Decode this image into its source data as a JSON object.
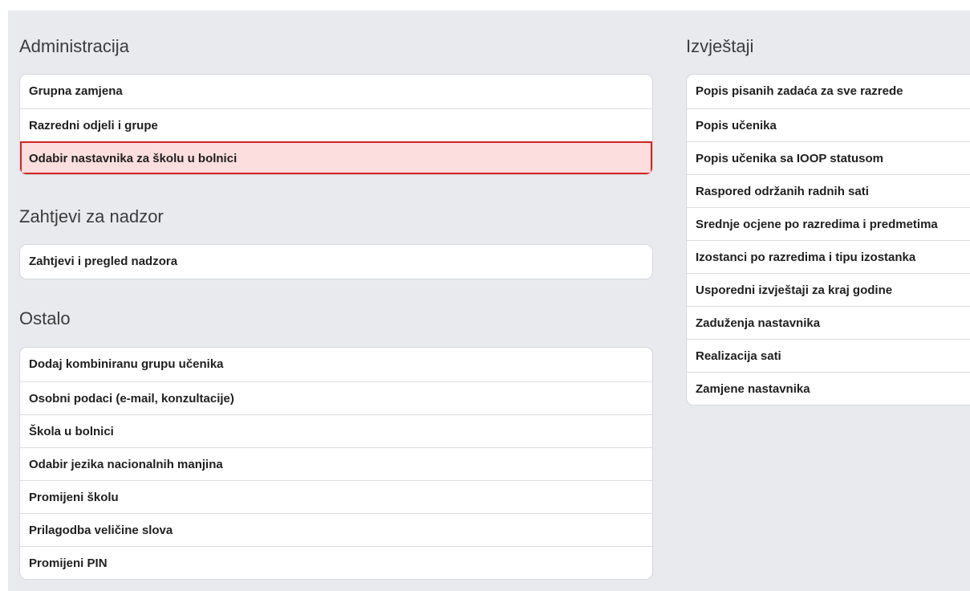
{
  "sections": {
    "administracija": {
      "title": "Administracija",
      "items": [
        {
          "label": "Grupna zamjena"
        },
        {
          "label": "Razredni odjeli i grupe"
        },
        {
          "label": "Odabir nastavnika za školu u bolnici"
        }
      ],
      "selected_index": 2
    },
    "nadzor": {
      "title": "Zahtjevi za nadzor",
      "items": [
        {
          "label": "Zahtjevi i pregled nadzora"
        }
      ]
    },
    "ostalo": {
      "title": "Ostalo",
      "items": [
        {
          "label": "Dodaj kombiniranu grupu učenika"
        },
        {
          "label": "Osobni podaci (e-mail, konzultacije)"
        },
        {
          "label": "Škola u bolnici"
        },
        {
          "label": "Odabir jezika nacionalnih manjina"
        },
        {
          "label": "Promijeni školu"
        },
        {
          "label": "Prilagodba veličine slova"
        },
        {
          "label": "Promijeni PIN"
        }
      ]
    },
    "izvjestaji": {
      "title": "Izvještaji",
      "items": [
        {
          "label": "Popis pisanih zadaća za sve razrede"
        },
        {
          "label": "Popis učenika"
        },
        {
          "label": "Popis učenika sa IOOP statusom"
        },
        {
          "label": "Raspored održanih radnih sati"
        },
        {
          "label": "Srednje ocjene po razredima i predmetima"
        },
        {
          "label": "Izostanci po razredima i tipu izostanka"
        },
        {
          "label": "Usporedni izvještaji za kraj godine"
        },
        {
          "label": "Zaduženja nastavnika"
        },
        {
          "label": "Realizacija sati"
        },
        {
          "label": "Zamjene nastavnika"
        }
      ]
    }
  },
  "colors": {
    "selected_background": "#fcdede",
    "selected_border": "#d32424",
    "page_background": "#e8eaed"
  }
}
